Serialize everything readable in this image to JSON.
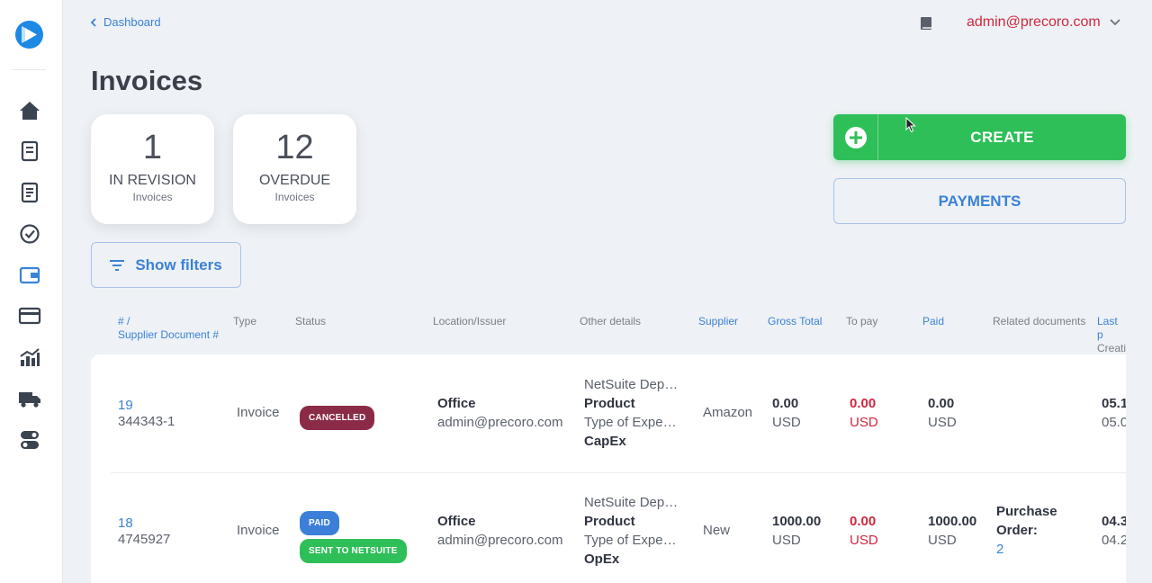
{
  "sidebar": {
    "items": [
      {
        "name": "home-icon"
      },
      {
        "name": "purchase-requests-icon"
      },
      {
        "name": "purchase-orders-icon"
      },
      {
        "name": "approvals-icon"
      },
      {
        "name": "invoices-wallet-icon"
      },
      {
        "name": "payments-card-icon"
      },
      {
        "name": "analytics-icon"
      },
      {
        "name": "suppliers-truck-icon"
      },
      {
        "name": "settings-toggle-icon"
      }
    ],
    "accent": "#3b82d6"
  },
  "header": {
    "breadcrumb": "Dashboard",
    "user_email": "admin@precoro.com"
  },
  "page": {
    "title": "Invoices"
  },
  "stats": [
    {
      "count": "1",
      "label": "IN REVISION",
      "sub": "Invoices"
    },
    {
      "count": "12",
      "label": "OVERDUE",
      "sub": "Invoices"
    }
  ],
  "actions": {
    "create_label": "CREATE",
    "payments_label": "PAYMENTS",
    "filters_label": "Show filters"
  },
  "table": {
    "columns": {
      "id": "# /",
      "id2": "Supplier Document #",
      "type": "Type",
      "status": "Status",
      "location": "Location/Issuer",
      "other": "Other details",
      "supplier": "Supplier",
      "gross": "Gross Total",
      "topay": "To pay",
      "paid": "Paid",
      "related": "Related documents",
      "last": "Last p",
      "last2": "Creati"
    },
    "rows": [
      {
        "id": "19",
        "doc": "344343-1",
        "type": "Invoice",
        "statuses": [
          {
            "label": "CANCELLED",
            "color": "#8b2b47"
          }
        ],
        "location": "Office",
        "issuer": "admin@precoro.com",
        "other1": "NetSuite Depa…",
        "other2": "Product",
        "other3": "Type of Expen…",
        "other4": "CapEx",
        "supplier": "Amazon",
        "gross": "0.00",
        "gross_cur": "USD",
        "topay": "0.00",
        "topay_cur": "USD",
        "paid": "0.00",
        "paid_cur": "USD",
        "related_label": "",
        "related_value": "",
        "last": "05.1",
        "created": "05.0"
      },
      {
        "id": "18",
        "doc": "4745927",
        "type": "Invoice",
        "statuses": [
          {
            "label": "PAID",
            "color": "#3b7fd9"
          },
          {
            "label": "SENT TO NETSUITE",
            "color": "#2fbf59"
          }
        ],
        "location": "Office",
        "issuer": "admin@precoro.com",
        "other1": "NetSuite Depa…",
        "other2": "Product",
        "other3": "Type of Expen…",
        "other4": "OpEx",
        "supplier": "New",
        "gross": "1000.00",
        "gross_cur": "USD",
        "topay": "0.00",
        "topay_cur": "USD",
        "paid": "1000.00",
        "paid_cur": "USD",
        "related_label": "Purchase Order:",
        "related_value": "2",
        "last": "04.3",
        "created": "04.2"
      }
    ]
  }
}
